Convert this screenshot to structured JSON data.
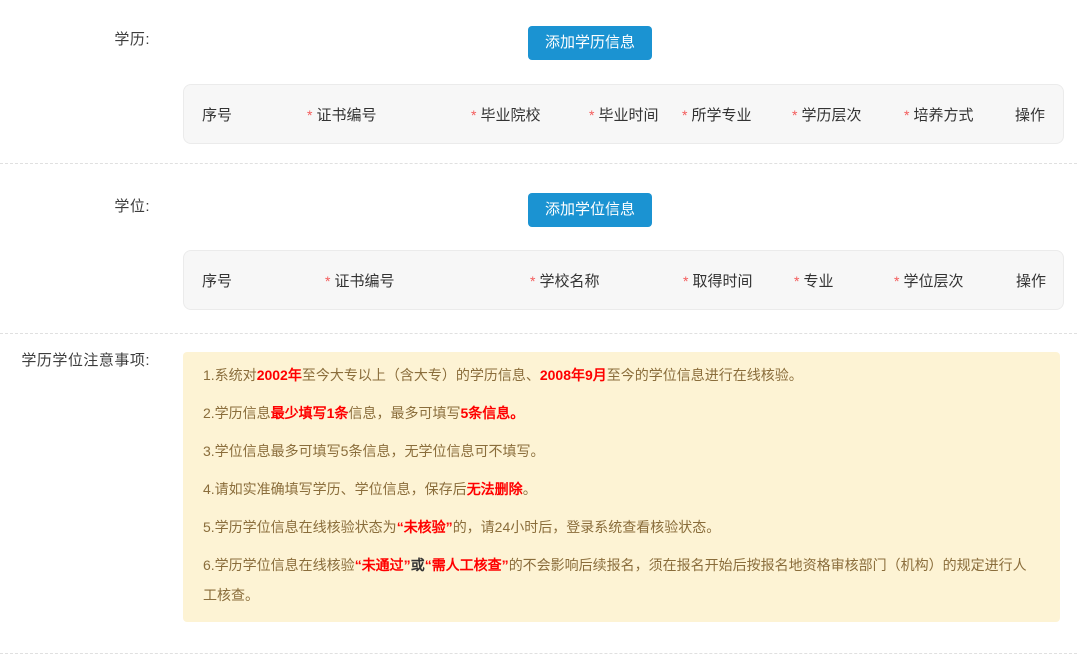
{
  "colors": {
    "accent_blue": "#1b93d2",
    "note_background": "#fdf3d4",
    "note_text": "#8a6d3b",
    "highlight_red": "#ff0000",
    "required_asterisk": "#f45b5b"
  },
  "education_section": {
    "label": "学历:",
    "add_button": "添加学历信息",
    "table_columns": [
      {
        "label": "序号",
        "required": false
      },
      {
        "label": "证书编号",
        "required": true
      },
      {
        "label": "毕业院校",
        "required": true
      },
      {
        "label": "毕业时间",
        "required": true
      },
      {
        "label": "所学专业",
        "required": true
      },
      {
        "label": "学历层次",
        "required": true
      },
      {
        "label": "培养方式",
        "required": true
      },
      {
        "label": "操作",
        "required": false
      }
    ]
  },
  "degree_section": {
    "label": "学位:",
    "add_button": "添加学位信息",
    "table_columns": [
      {
        "label": "序号",
        "required": false
      },
      {
        "label": "证书编号",
        "required": true
      },
      {
        "label": "学校名称",
        "required": true
      },
      {
        "label": "取得时间",
        "required": true
      },
      {
        "label": "专业",
        "required": true
      },
      {
        "label": "学位层次",
        "required": true
      },
      {
        "label": "操作",
        "required": false
      }
    ]
  },
  "notes_section": {
    "label": "学历学位注意事项:",
    "notes": [
      [
        {
          "t": "1.系统对"
        },
        {
          "t": "2002年",
          "s": "red"
        },
        {
          "t": "至今大专以上（含大专）的学历信息、"
        },
        {
          "t": "2008年9月",
          "s": "red"
        },
        {
          "t": "至今的学位信息进行在线核验。"
        }
      ],
      [
        {
          "t": "2.学历信息"
        },
        {
          "t": "最少填写1条",
          "s": "red"
        },
        {
          "t": "信息，最多可填写"
        },
        {
          "t": "5条信息。",
          "s": "red"
        }
      ],
      [
        {
          "t": "3.学位信息最多可填写5条信息，无学位信息可不填写。"
        }
      ],
      [
        {
          "t": "4.请如实准确填写学历、学位信息，保存后"
        },
        {
          "t": "无法删除",
          "s": "red"
        },
        {
          "t": "。"
        }
      ],
      [
        {
          "t": "5.学历学位信息在线核验状态为"
        },
        {
          "t": "“未核验”",
          "s": "red"
        },
        {
          "t": "的，请24小时后，登录系统查看核验状态。"
        }
      ],
      [
        {
          "t": "6.学历学位信息在线核验"
        },
        {
          "t": "“未通过”",
          "s": "red"
        },
        {
          "t": "或",
          "s": "dark"
        },
        {
          "t": "“需人工核查”",
          "s": "red"
        },
        {
          "t": "的不会影响后续报名，须在报名开始后按报名地资格审核部门（机构）的规定进行人工核查。"
        }
      ]
    ]
  }
}
